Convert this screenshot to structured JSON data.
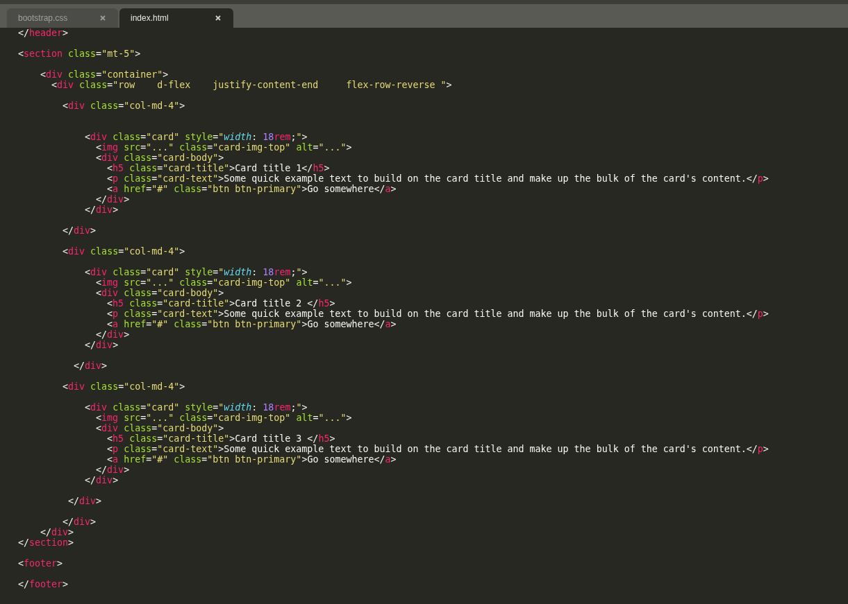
{
  "tabs": [
    {
      "label": "bootstrap.css",
      "selected": false
    },
    {
      "label": "index.html",
      "selected": true
    }
  ],
  "editor": {
    "lines": [
      {
        "kind": "code",
        "text": "</header>"
      },
      {
        "kind": "blank"
      },
      {
        "kind": "code",
        "text": "<section class=\"mt-5\">"
      },
      {
        "kind": "blank"
      },
      {
        "kind": "code",
        "text": "    <div class=\"container\">"
      },
      {
        "kind": "code",
        "text": "      <div class=\"row    d-flex    justify-content-end     flex-row-reverse \">"
      },
      {
        "kind": "blank"
      },
      {
        "kind": "code",
        "text": "        <div class=\"col-md-4\">"
      },
      {
        "kind": "blank"
      },
      {
        "kind": "blank"
      },
      {
        "kind": "code",
        "text": "            <div class=\"card\" style=\"width: 18rem;\">"
      },
      {
        "kind": "code",
        "text": "              <img src=\"...\" class=\"card-img-top\" alt=\"...\">"
      },
      {
        "kind": "code",
        "text": "              <div class=\"card-body\">"
      },
      {
        "kind": "code",
        "text": "                <h5 class=\"card-title\">Card title 1</h5>"
      },
      {
        "kind": "code",
        "text": "                <p class=\"card-text\">Some quick example text to build on the card title and make up the bulk of the card's content.</p>"
      },
      {
        "kind": "code",
        "text": "                <a href=\"#\" class=\"btn btn-primary\">Go somewhere</a>"
      },
      {
        "kind": "code",
        "text": "              </div>"
      },
      {
        "kind": "code",
        "text": "            </div>"
      },
      {
        "kind": "blank"
      },
      {
        "kind": "code",
        "text": "        </div>"
      },
      {
        "kind": "blank"
      },
      {
        "kind": "code",
        "text": "        <div class=\"col-md-4\">"
      },
      {
        "kind": "blank"
      },
      {
        "kind": "code",
        "text": "            <div class=\"card\" style=\"width: 18rem;\">"
      },
      {
        "kind": "code",
        "text": "              <img src=\"...\" class=\"card-img-top\" alt=\"...\">"
      },
      {
        "kind": "code",
        "text": "              <div class=\"card-body\">"
      },
      {
        "kind": "code",
        "text": "                <h5 class=\"card-title\">Card title 2 </h5>"
      },
      {
        "kind": "code",
        "text": "                <p class=\"card-text\">Some quick example text to build on the card title and make up the bulk of the card's content.</p>"
      },
      {
        "kind": "code",
        "text": "                <a href=\"#\" class=\"btn btn-primary\">Go somewhere</a>"
      },
      {
        "kind": "code",
        "text": "              </div>"
      },
      {
        "kind": "code",
        "text": "            </div>"
      },
      {
        "kind": "blank"
      },
      {
        "kind": "code",
        "text": "          </div>"
      },
      {
        "kind": "blank"
      },
      {
        "kind": "code",
        "text": "        <div class=\"col-md-4\">"
      },
      {
        "kind": "blank"
      },
      {
        "kind": "code",
        "text": "            <div class=\"card\" style=\"width: 18rem;\">"
      },
      {
        "kind": "code",
        "text": "              <img src=\"...\" class=\"card-img-top\" alt=\"...\">"
      },
      {
        "kind": "code",
        "text": "              <div class=\"card-body\">"
      },
      {
        "kind": "code",
        "text": "                <h5 class=\"card-title\">Card title 3 </h5>"
      },
      {
        "kind": "code",
        "text": "                <p class=\"card-text\">Some quick example text to build on the card title and make up the bulk of the card's content.</p>"
      },
      {
        "kind": "code",
        "text": "                <a href=\"#\" class=\"btn btn-primary\">Go somewhere</a>"
      },
      {
        "kind": "code",
        "text": "              </div>"
      },
      {
        "kind": "code",
        "text": "            </div>"
      },
      {
        "kind": "blank"
      },
      {
        "kind": "code",
        "text": "         </div>"
      },
      {
        "kind": "blank"
      },
      {
        "kind": "code",
        "text": "        </div>"
      },
      {
        "kind": "code",
        "text": "    </div>"
      },
      {
        "kind": "code",
        "text": "</section>"
      },
      {
        "kind": "blank"
      },
      {
        "kind": "code",
        "text": "<footer>"
      },
      {
        "kind": "blank"
      },
      {
        "kind": "code",
        "text": "</footer>"
      }
    ]
  }
}
